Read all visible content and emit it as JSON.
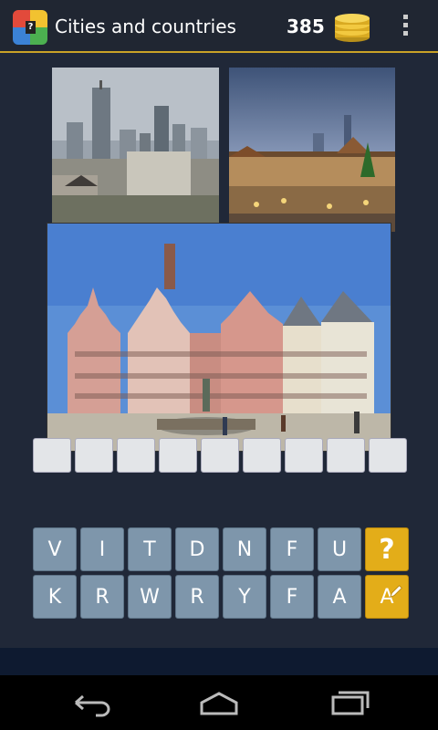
{
  "header": {
    "title": "Cities and countries",
    "coins": "385",
    "app_icon": "puzzle-photo-icon",
    "coins_icon": "coin-stack-icon",
    "menu_icon": "overflow-menu-icon"
  },
  "puzzle": {
    "photos": [
      {
        "subject": "skyline-photo"
      },
      {
        "subject": "christmas-market-photo"
      },
      {
        "subject": "town-hall-square-photo"
      }
    ],
    "answer_length": 9
  },
  "keyboard": {
    "row1": [
      "V",
      "I",
      "T",
      "D",
      "N",
      "F",
      "U"
    ],
    "row2": [
      "K",
      "R",
      "W",
      "R",
      "Y",
      "F",
      "A"
    ],
    "help_label": "?",
    "reveal_label": "A",
    "reveal_icon": "pencil-icon"
  },
  "navigation": {
    "back_icon": "back-icon",
    "home_icon": "home-icon",
    "recents_icon": "recents-icon"
  },
  "colors": {
    "background": "#202838",
    "accent": "#c9a227",
    "key": "#7e96ab",
    "hint_key": "#e3ad19"
  }
}
